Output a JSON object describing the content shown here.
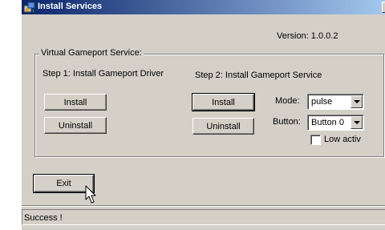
{
  "window": {
    "title": "Install Services",
    "close_glyph": "×"
  },
  "version_label": "Version: 1.0.0.2",
  "group": {
    "title": "Virtual Gameport Service:",
    "step1": {
      "label": "Step 1: Install Gameport Driver",
      "install_label": "Install",
      "uninstall_label": "Uninstall"
    },
    "step2": {
      "label": "Step 2: Install Gameport Service",
      "install_label": "Install",
      "uninstall_label": "Uninstall"
    },
    "mode": {
      "label": "Mode:",
      "value": "pulse"
    },
    "button": {
      "label": "Button:",
      "value": "Button 0"
    },
    "low_active": {
      "label": "Low activ",
      "checked": false
    }
  },
  "exit_label": "Exit",
  "status_text": "Success !",
  "icons": {
    "app": "install-app-icon",
    "cursor": "mouse-pointer-icon"
  },
  "colors": {
    "titlebar_start": "#0a246a",
    "titlebar_end": "#a6caf0",
    "face": "#d4d0c8"
  }
}
